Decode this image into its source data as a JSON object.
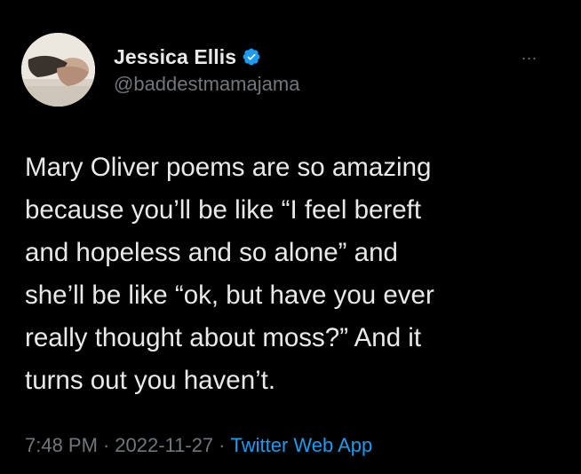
{
  "tweet": {
    "author": {
      "display_name": "Jessica Ellis",
      "handle": "@baddestmamajama",
      "verified": true,
      "verified_icon": "verified-badge-icon",
      "avatar": "avatar-photo"
    },
    "more_icon": "more-options-icon",
    "more_glyph": "...",
    "text": "Mary Oliver poems are so amazing\nbecause you’ll be like “I feel bereft\nand hopeless and so alone” and\nshe’ll be like “ok, but have you ever\nreally thought about moss?” And it\nturns out you haven’t.",
    "time": "7:48 PM",
    "separator": "·",
    "date": "2022-11-27",
    "source": "Twitter Web App"
  },
  "colors": {
    "background": "#000000",
    "text": "#e7e9ea",
    "secondary": "#71767b",
    "accent": "#1d9bf0"
  }
}
